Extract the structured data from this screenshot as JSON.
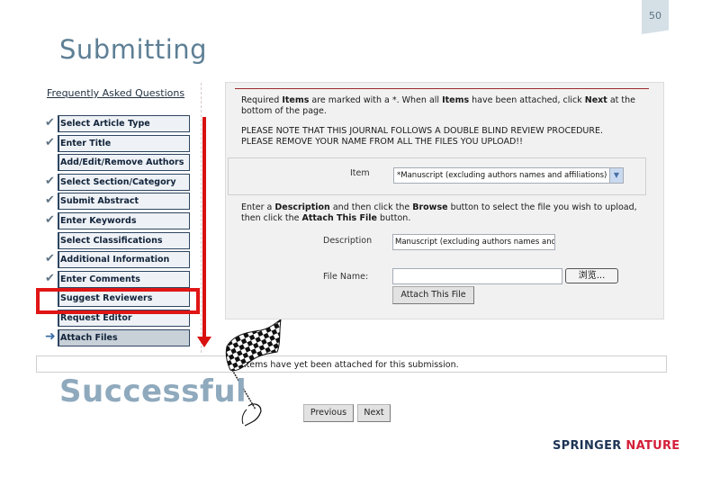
{
  "slide": {
    "page_number": "50",
    "title": "Submitting",
    "caption": "Successful"
  },
  "sidebar": {
    "faq_link": "Frequently Asked Questions",
    "steps": [
      {
        "label": "Select Article Type",
        "status": "done"
      },
      {
        "label": "Enter Title",
        "status": "done"
      },
      {
        "label": "Add/Edit/Remove Authors",
        "status": "none"
      },
      {
        "label": "Select Section/Category",
        "status": "done"
      },
      {
        "label": "Submit Abstract",
        "status": "done"
      },
      {
        "label": "Enter Keywords",
        "status": "done"
      },
      {
        "label": "Select Classifications",
        "status": "none"
      },
      {
        "label": "Additional Information",
        "status": "done"
      },
      {
        "label": "Enter Comments",
        "status": "done"
      },
      {
        "label": "Suggest Reviewers",
        "status": "highlighted"
      },
      {
        "label": "Request Editor",
        "status": "none"
      },
      {
        "label": "Attach Files",
        "status": "current"
      }
    ],
    "icons": {
      "done": "checkmark-icon",
      "current": "arrow-right-icon"
    }
  },
  "main": {
    "notice_parts": [
      "Required ",
      "Items",
      " are marked with a *. When all ",
      "Items",
      " have been attached, click ",
      "Next",
      " at the bottom of the page."
    ],
    "notice_line2a": "PLEASE NOTE THAT THIS JOURNAL FOLLOWS A DOUBLE BLIND REVIEW PROCEDURE.",
    "notice_line2b": "PLEASE REMOVE YOUR NAME FROM ALL THE FILES YOU UPLOAD!!",
    "item_label": "Item",
    "item_selected": "*Manuscript (excluding authors names and affiliations)",
    "instruction_parts": [
      "Enter a ",
      "Description",
      " and then click the ",
      "Browse",
      " button to select the file you wish to upload, then click the ",
      "Attach This File",
      " button."
    ],
    "description_label": "Description",
    "description_value": "Manuscript (excluding authors names and",
    "file_name_label": "File Name:",
    "file_name_value": "",
    "browse_button": "浏览...",
    "attach_button": "Attach This File",
    "no_items_text": "No items have yet been attached for this submission.",
    "previous_button": "Previous",
    "next_button": "Next"
  },
  "brand": {
    "logo_part1": "SPRINGER",
    "logo_part2": "NATURE",
    "colors": {
      "navy": "#1d3455",
      "red": "#d3203a",
      "highlight": "#e01515"
    }
  }
}
